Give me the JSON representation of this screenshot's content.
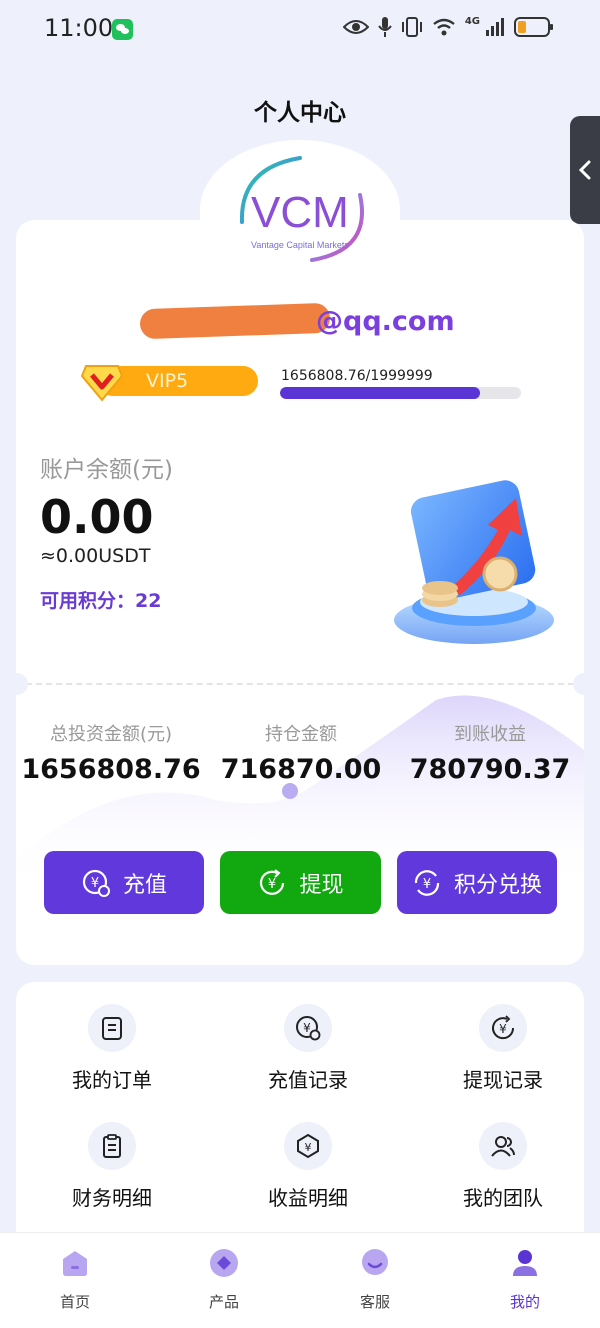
{
  "status_bar": {
    "time": "11:00",
    "network": "4G"
  },
  "header": {
    "title": "个人中心"
  },
  "logo": {
    "text": "VCM",
    "subtitle": "Vantage Capital Markets"
  },
  "user": {
    "email_suffix": "@qq.com"
  },
  "vip": {
    "level": "VIP5",
    "progress_text": "1656808.76/1999999",
    "progress_fraction": 0.828
  },
  "balance": {
    "label": "账户余额(元)",
    "value": "0.00",
    "usdt": "≈0.00USDT",
    "points": "可用积分：22"
  },
  "stats": [
    {
      "label": "总投资金额(元)",
      "value": "1656808.76"
    },
    {
      "label": "持仓金额",
      "value": "716870.00"
    },
    {
      "label": "到账收益",
      "value": "780790.37"
    }
  ],
  "actions": {
    "recharge": "充值",
    "withdraw": "提现",
    "exchange": "积分兑换"
  },
  "menu": [
    {
      "label": "我的订单",
      "icon": "order-icon"
    },
    {
      "label": "充值记录",
      "icon": "recharge-record-icon"
    },
    {
      "label": "提现记录",
      "icon": "withdraw-record-icon"
    },
    {
      "label": "财务明细",
      "icon": "finance-icon"
    },
    {
      "label": "收益明细",
      "icon": "income-icon"
    },
    {
      "label": "我的团队",
      "icon": "team-icon"
    }
  ],
  "tabs": [
    {
      "label": "首页",
      "icon": "home-icon"
    },
    {
      "label": "产品",
      "icon": "product-icon"
    },
    {
      "label": "客服",
      "icon": "support-icon"
    },
    {
      "label": "我的",
      "icon": "profile-icon",
      "active": true
    }
  ],
  "colors": {
    "accent": "#5b34d6",
    "withdraw": "#12a810",
    "vip": "#ffaa10",
    "background": "#eef1fb"
  }
}
